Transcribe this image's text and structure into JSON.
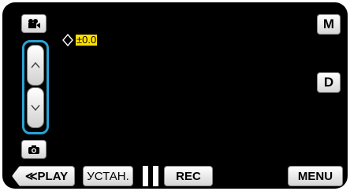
{
  "exposure": {
    "value": "±0.0"
  },
  "buttons": {
    "m_label": "M",
    "d_label": "D",
    "play_label": "≪PLAY",
    "setup_label": "УСТАН.",
    "rec_label": "REC",
    "menu_label": "MENU"
  },
  "icons": {
    "mode_movie": "movie-camera-icon",
    "mode_photo": "still-camera-icon",
    "up": "chevron-up-icon",
    "down": "chevron-down-icon",
    "exposure": "diamond-adjust-icon",
    "pause": "pause-icon"
  },
  "colors": {
    "accent_frame": "#29a3d6",
    "value_highlight": "#ffe000",
    "background": "#000000"
  }
}
